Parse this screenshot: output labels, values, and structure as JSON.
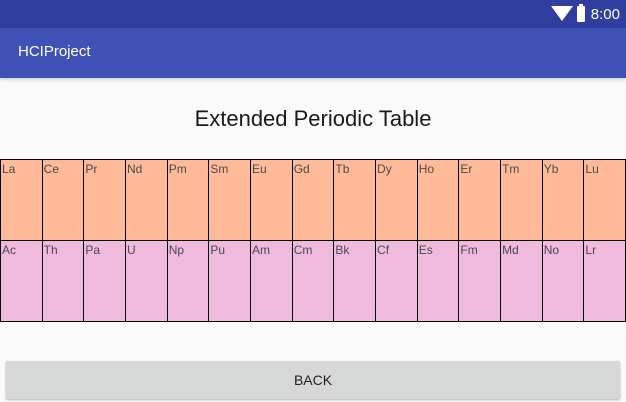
{
  "status_bar": {
    "time": "8:00",
    "icons": [
      "wifi-icon",
      "battery-icon"
    ]
  },
  "app_bar": {
    "title": "HCIProject"
  },
  "main": {
    "heading": "Extended Periodic Table",
    "lanthanides": [
      "La",
      "Ce",
      "Pr",
      "Nd",
      "Pm",
      "Sm",
      "Eu",
      "Gd",
      "Tb",
      "Dy",
      "Ho",
      "Er",
      "Tm",
      "Yb",
      "Lu"
    ],
    "actinides": [
      "Ac",
      "Th",
      "Pa",
      "U",
      "Np",
      "Pu",
      "Am",
      "Cm",
      "Bk",
      "Cf",
      "Es",
      "Fm",
      "Md",
      "No",
      "Lr"
    ],
    "colors": {
      "lanthanide_fill": "#ffbb99",
      "actinide_fill": "#f0bade"
    }
  },
  "footer": {
    "back_label": "BACK"
  }
}
